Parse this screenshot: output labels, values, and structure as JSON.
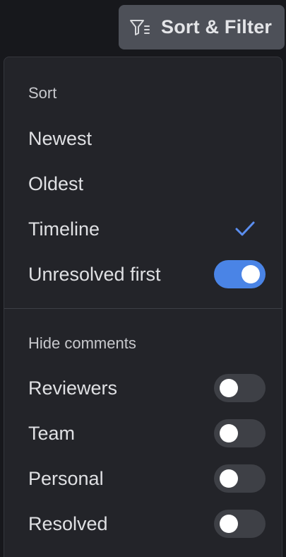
{
  "toolbar": {
    "sort_filter_label": "Sort & Filter",
    "icon": "filter-icon"
  },
  "sort": {
    "title": "Sort",
    "options": [
      {
        "label": "Newest",
        "selected": false
      },
      {
        "label": "Oldest",
        "selected": false
      },
      {
        "label": "Timeline",
        "selected": true
      }
    ],
    "unresolved_first": {
      "label": "Unresolved first",
      "enabled": true
    }
  },
  "hide": {
    "title": "Hide comments",
    "items": [
      {
        "label": "Reviewers",
        "enabled": false
      },
      {
        "label": "Team",
        "enabled": false
      },
      {
        "label": "Personal",
        "enabled": false
      },
      {
        "label": "Resolved",
        "enabled": false
      }
    ]
  },
  "colors": {
    "accent": "#4a84e6",
    "check": "#5b8ef0",
    "panel_bg": "#232429",
    "button_bg": "#4d5058"
  }
}
